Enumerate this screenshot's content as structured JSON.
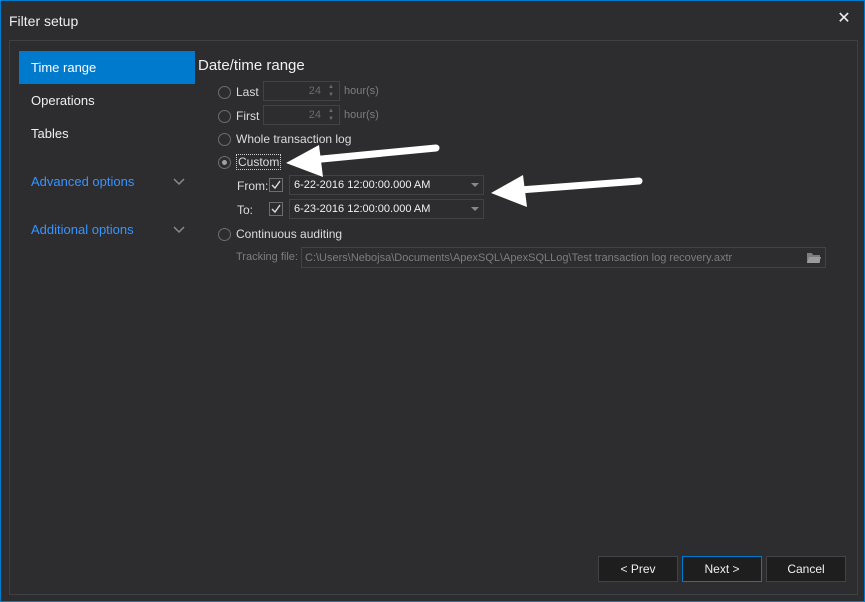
{
  "window": {
    "title": "Filter setup"
  },
  "sidebar": {
    "items": [
      {
        "label": "Time range"
      },
      {
        "label": "Operations"
      },
      {
        "label": "Tables"
      }
    ],
    "groups": [
      {
        "label": "Advanced options"
      },
      {
        "label": "Additional options"
      }
    ]
  },
  "main": {
    "section_title": "Date/time range",
    "last": {
      "label": "Last",
      "value": "24",
      "unit": "hour(s)"
    },
    "first": {
      "label": "First",
      "value": "24",
      "unit": "hour(s)"
    },
    "whole": {
      "label": "Whole transaction log"
    },
    "custom": {
      "label": "Custom",
      "from_label": "From:",
      "from_value": "6-22-2016 12:00:00.000 AM",
      "to_label": "To:",
      "to_value": "6-23-2016 12:00:00.000 AM"
    },
    "continuous": {
      "label": "Continuous auditing"
    },
    "tracking": {
      "label": "Tracking file:",
      "value": "C:\\Users\\Nebojsa\\Documents\\ApexSQL\\ApexSQLLog\\Test transaction log recovery.axtr"
    }
  },
  "buttons": {
    "prev": "< Prev",
    "next": "Next >",
    "cancel": "Cancel"
  },
  "colors": {
    "accent": "#007acc",
    "link": "#3794ff",
    "background": "#2d2d30"
  },
  "icons": [
    "close-icon",
    "chevron-down-icon",
    "checkmark-icon",
    "folder-icon",
    "dropdown-arrow-icon"
  ]
}
